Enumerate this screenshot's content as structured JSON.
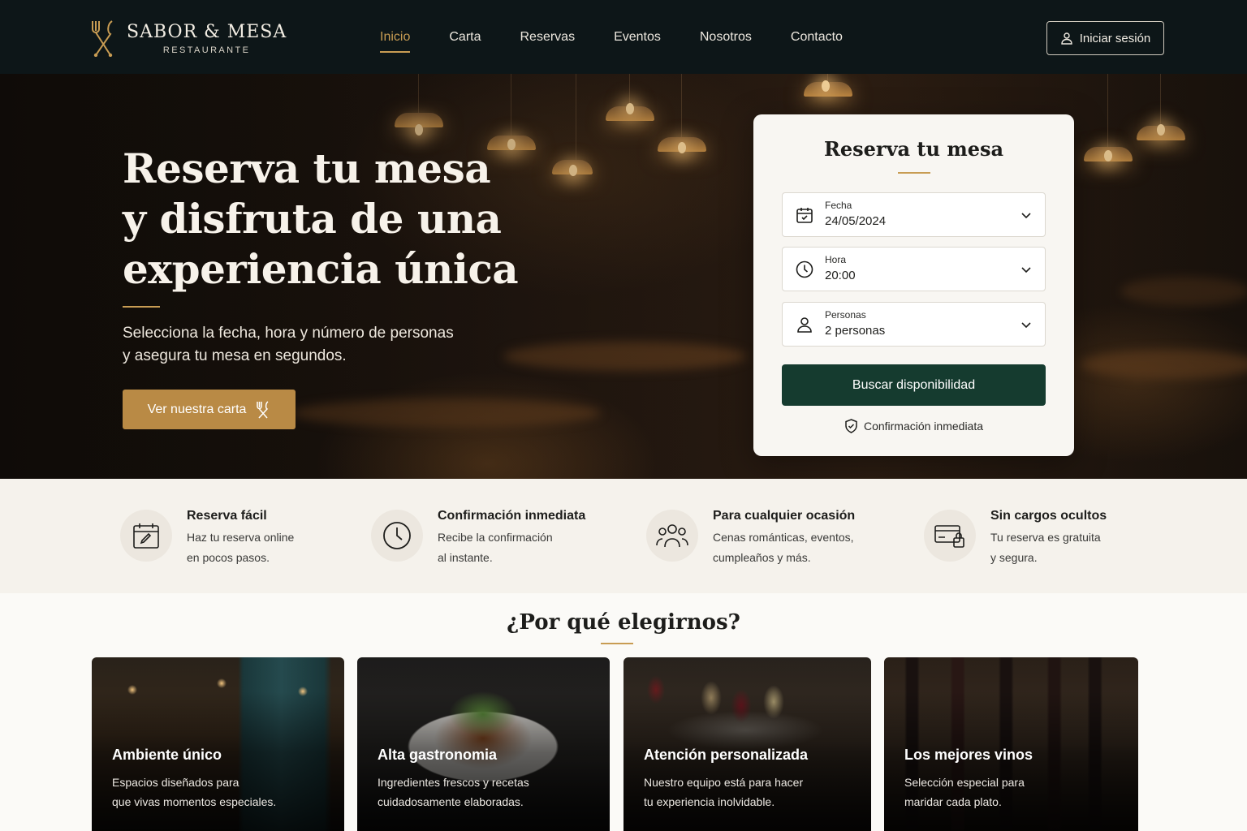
{
  "brand": {
    "name": "SABOR & MESA",
    "tagline": "RESTAURANTE",
    "accent": "#c89c53",
    "dark": "#0d1618",
    "primary_button": "#153b2f"
  },
  "nav": {
    "items": [
      {
        "label": "Inicio",
        "active": true
      },
      {
        "label": "Carta",
        "active": false
      },
      {
        "label": "Reservas",
        "active": false
      },
      {
        "label": "Eventos",
        "active": false
      },
      {
        "label": "Nosotros",
        "active": false
      },
      {
        "label": "Contacto",
        "active": false
      }
    ],
    "login_label": "Iniciar sesión"
  },
  "hero": {
    "title_lines": [
      "Reserva tu mesa",
      "y disfruta de una",
      "experiencia única"
    ],
    "subtitle_lines": [
      "Selecciona la fecha, hora y número de personas",
      "y asegura tu mesa en segundos."
    ],
    "cta_label": "Ver nuestra carta"
  },
  "booking": {
    "title": "Reserva tu mesa",
    "fields": [
      {
        "label": "Fecha",
        "value": "24/05/2024",
        "icon": "calendar-icon"
      },
      {
        "label": "Hora",
        "value": "20:00",
        "icon": "clock-icon"
      },
      {
        "label": "Personas",
        "value": "2 personas",
        "icon": "user-icon"
      }
    ],
    "submit_label": "Buscar disponibilidad",
    "note": "Confirmación inmediata"
  },
  "features": [
    {
      "title": "Reserva fácil",
      "desc_lines": [
        "Haz tu reserva online",
        "en pocos pasos."
      ],
      "icon": "calendar-edit-icon"
    },
    {
      "title": "Confirmación inmediata",
      "desc_lines": [
        "Recibe la confirmación",
        "al instante."
      ],
      "icon": "clock-icon"
    },
    {
      "title": "Para cualquier ocasión",
      "desc_lines": [
        "Cenas románticas, eventos,",
        "cumpleaños y más."
      ],
      "icon": "group-icon"
    },
    {
      "title": "Sin cargos ocultos",
      "desc_lines": [
        "Tu reserva es gratuita",
        "y segura."
      ],
      "icon": "secure-card-icon"
    }
  ],
  "why": {
    "title": "¿Por qué elegirnos?",
    "cards": [
      {
        "title": "Ambiente único",
        "desc_lines": [
          "Espacios diseñados para",
          "que vivas momentos especiales."
        ]
      },
      {
        "title": "Alta gastronomia",
        "desc_lines": [
          "Ingredientes frescos y recetas",
          "cuidadosamente elaboradas."
        ]
      },
      {
        "title": "Atención personalizada",
        "desc_lines": [
          "Nuestro equipo está para hacer",
          "tu experiencia inolvidable."
        ]
      },
      {
        "title": "Los mejores vinos",
        "desc_lines": [
          "Selección especial para",
          "maridar cada plato."
        ]
      }
    ]
  }
}
